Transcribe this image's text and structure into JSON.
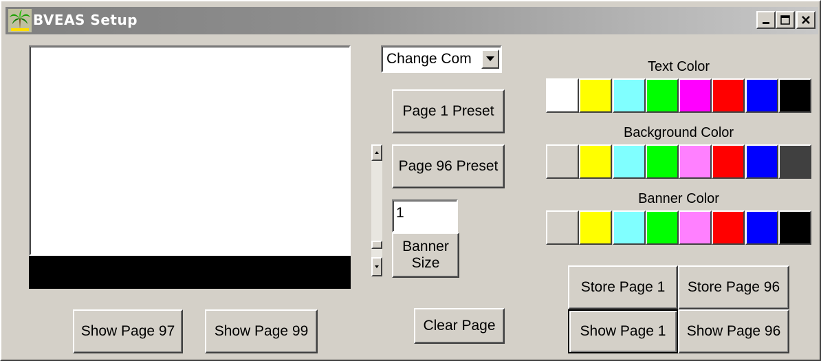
{
  "window": {
    "title": "BVEAS Setup"
  },
  "dropdown": {
    "value": "Change Com"
  },
  "buttons": {
    "page1_preset": "Page 1 Preset",
    "page96_preset": "Page 96 Preset",
    "banner_size": "Banner\nSize",
    "clear_page": "Clear Page",
    "show_page_97": "Show Page 97",
    "show_page_99": "Show Page 99",
    "store_page_1": "Store Page 1",
    "store_page_96": "Store Page 96",
    "show_page_1": "Show Page 1",
    "show_page_96": "Show Page 96"
  },
  "banner_size_input": {
    "value": "1"
  },
  "palettes": {
    "text": {
      "label": "Text Color",
      "colors": [
        "#ffffff",
        "#ffff00",
        "#80ffff",
        "#00ff00",
        "#ff00ff",
        "#ff0000",
        "#0000ff",
        "#000000"
      ]
    },
    "background": {
      "label": "Background Color",
      "colors": [
        "#d4d0c8",
        "#ffff00",
        "#80ffff",
        "#00ff00",
        "#ff80ff",
        "#ff0000",
        "#0000ff",
        "#404040"
      ]
    },
    "banner": {
      "label": "Banner Color",
      "colors": [
        "#d4d0c8",
        "#ffff00",
        "#80ffff",
        "#00ff00",
        "#ff80ff",
        "#ff0000",
        "#0000ff",
        "#000000"
      ]
    }
  },
  "preview": {
    "banner_color": "#000000",
    "page_color": "#ffffff"
  }
}
